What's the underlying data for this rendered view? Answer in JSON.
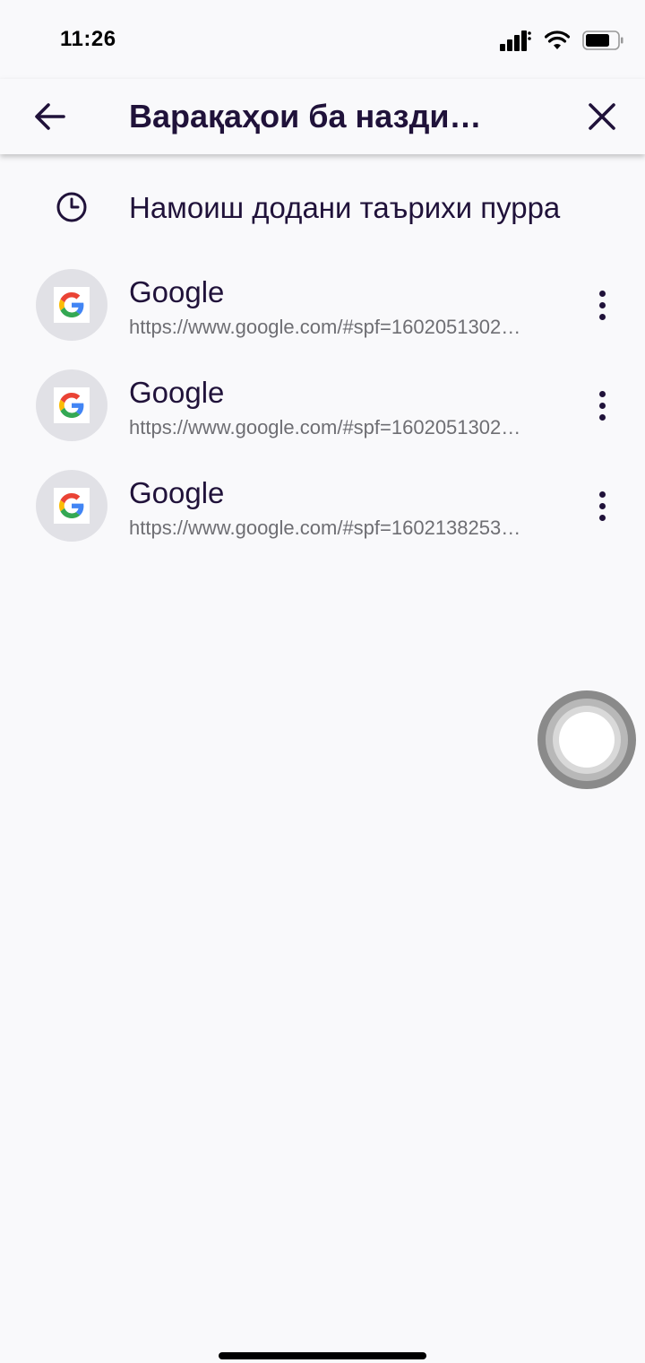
{
  "status_bar": {
    "time": "11:26",
    "icons": [
      "signal-icon",
      "wifi-icon",
      "battery-icon"
    ]
  },
  "toolbar": {
    "back_icon": "arrow-left-icon",
    "title": "Варақаҳои ба назди…",
    "close_icon": "close-icon"
  },
  "history": {
    "icon": "clock-icon",
    "label": "Намоиш додани таърихи пурра"
  },
  "tabs": [
    {
      "title": "Google",
      "url": "https://www.google.com/#spf=1602051302…",
      "icon": "google-favicon"
    },
    {
      "title": "Google",
      "url": "https://www.google.com/#spf=1602051302…",
      "icon": "google-favicon"
    },
    {
      "title": "Google",
      "url": "https://www.google.com/#spf=1602138253…",
      "icon": "google-favicon"
    }
  ],
  "colors": {
    "background": "#f9f9fb",
    "text_primary": "#20123a",
    "text_secondary": "#6e6e73",
    "favicon_bg": "#e1e1e6"
  }
}
